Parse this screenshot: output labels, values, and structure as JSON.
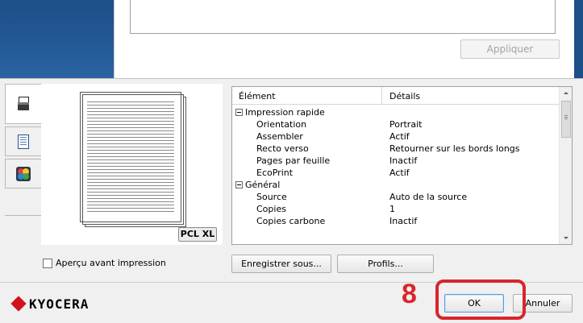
{
  "apply_button": {
    "label": "Appliquer"
  },
  "tabs": [
    {
      "icon": "printer-icon"
    },
    {
      "icon": "document-icon"
    },
    {
      "icon": "color-icon"
    }
  ],
  "preview": {
    "badge": "PCL XL"
  },
  "details": {
    "columns": [
      "Élément",
      "Détails"
    ],
    "rows": [
      {
        "type": "group",
        "label": "Impression rapide"
      },
      {
        "type": "item",
        "label": "Orientation",
        "value": "Portrait"
      },
      {
        "type": "item",
        "label": "Assembler",
        "value": "Actif"
      },
      {
        "type": "item",
        "label": "Recto verso",
        "value": "Retourner sur les bords longs"
      },
      {
        "type": "item",
        "label": "Pages par feuille",
        "value": "Inactif"
      },
      {
        "type": "item",
        "label": "EcoPrint",
        "value": "Actif"
      },
      {
        "type": "group",
        "label": "Général"
      },
      {
        "type": "item",
        "label": "Source",
        "value": "Auto de la source"
      },
      {
        "type": "item",
        "label": "Copies",
        "value": "1"
      },
      {
        "type": "item",
        "label": "Copies carbone",
        "value": "Inactif"
      }
    ]
  },
  "preview_checkbox": {
    "label": "Aperçu avant impression",
    "checked": false
  },
  "buttons": {
    "save_as": "Enregistrer sous...",
    "profiles": "Profils...",
    "ok": "OK",
    "cancel": "Annuler"
  },
  "brand": {
    "name": "KYOCERA"
  },
  "callout": {
    "number": "8",
    "color": "#d9252c"
  }
}
